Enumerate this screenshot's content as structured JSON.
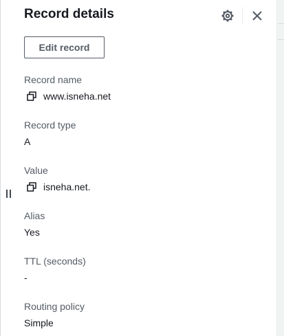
{
  "panel": {
    "title": "Record details",
    "settings_icon": "gear-icon",
    "close_icon": "close-icon",
    "edit_button_label": "Edit record"
  },
  "fields": {
    "record_name": {
      "label": "Record name",
      "value": "www.isneha.net",
      "icon": "copy-icon"
    },
    "record_type": {
      "label": "Record type",
      "value": "A"
    },
    "value": {
      "label": "Value",
      "value": "isneha.net.",
      "icon": "copy-icon"
    },
    "alias": {
      "label": "Alias",
      "value": "Yes"
    },
    "ttl": {
      "label": "TTL (seconds)",
      "value": "-"
    },
    "routing_policy": {
      "label": "Routing policy",
      "value": "Simple"
    }
  },
  "colors": {
    "text_primary": "#16191f",
    "text_secondary": "#545b64",
    "border": "#d5dbdb"
  }
}
